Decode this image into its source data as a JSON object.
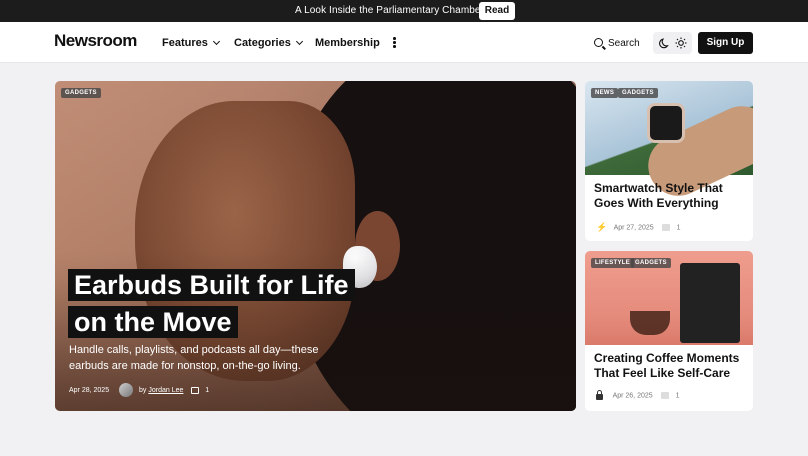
{
  "announcement": {
    "text": "A Look Inside the Parliamentary Chambers",
    "button": "Read"
  },
  "header": {
    "logo": "Newsroom",
    "nav": [
      {
        "label": "Features"
      },
      {
        "label": "Categories"
      },
      {
        "label": "Membership"
      }
    ],
    "search_label": "Search",
    "signup_label": "Sign Up"
  },
  "hero": {
    "badge": "GADGETS",
    "title_line1": "Earbuds Built for Life",
    "title_line2": "on the Move",
    "description": "Handle calls, playlists, and podcasts all day—these earbuds are made for nonstop, on-the-go living.",
    "date": "Apr 28, 2025",
    "by": "by",
    "author": "Jordan Lee",
    "comments": "1"
  },
  "cards": [
    {
      "badges": [
        "NEWS",
        "GADGETS"
      ],
      "title": "Smartwatch Style That Goes With Everything",
      "date": "Apr 27, 2025",
      "comments": "1",
      "icon": "bolt-icon"
    },
    {
      "badges": [
        "LIFESTYLE",
        "GADGETS"
      ],
      "title": "Creating Coffee Moments That Feel Like Self-Care",
      "date": "Apr 26, 2025",
      "comments": "1",
      "icon": "lock-icon"
    }
  ],
  "colors": {
    "accent": "#111111",
    "bolt": "#dd3333"
  }
}
